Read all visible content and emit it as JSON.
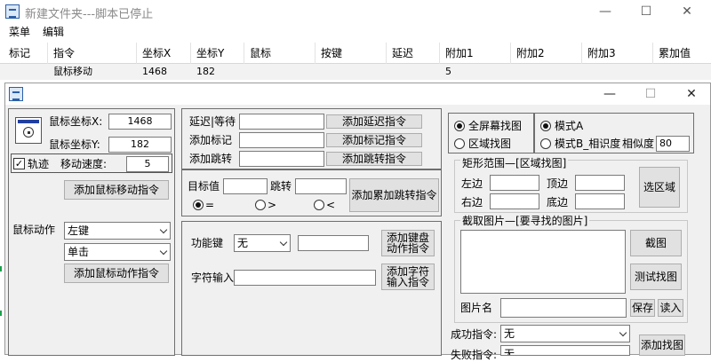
{
  "window": {
    "title": "新建文件夹---脚本已停止",
    "controls": {
      "minimize": "—",
      "maximize": "☐",
      "close": "✕"
    }
  },
  "menu": {
    "items": [
      "菜单",
      "编辑"
    ]
  },
  "grid": {
    "headers": [
      "标记",
      "指令",
      "坐标X",
      "坐标Y",
      "鼠标",
      "按键",
      "延迟",
      "附加1",
      "附加2",
      "附加3",
      "累加值"
    ],
    "rows": [
      {
        "mark": "",
        "cmd": "鼠标移动",
        "x": "1468",
        "y": "182",
        "mouse": "",
        "key": "",
        "delay": "",
        "add1": "5",
        "add2": "",
        "add3": "",
        "acc": ""
      }
    ]
  },
  "dialog": {
    "controls": {
      "minimize": "—",
      "maximize": "☐",
      "close": "✕"
    },
    "mouse": {
      "x_label": "鼠标坐标X:",
      "x_value": "1468",
      "y_label": "鼠标坐标Y:",
      "y_value": "182",
      "track_label": "轨迹",
      "track_checked": true,
      "speed_label": "移动速度:",
      "speed_value": "5",
      "add_move_btn": "添加鼠标移动指令",
      "action_label": "鼠标动作",
      "button_select": "左键",
      "click_select": "单击",
      "add_action_btn": "添加鼠标动作指令"
    },
    "delay": {
      "delay_label": "延迟|等待",
      "delay_value": "",
      "delay_btn": "添加延迟指令",
      "mark_label": "添加标记",
      "mark_value": "",
      "mark_btn": "添加标记指令",
      "jump_label": "添加跳转",
      "jump_value": "",
      "jump_btn": "添加跳转指令"
    },
    "target": {
      "target_label": "目标值",
      "target_value": "",
      "jump_label": "跳转",
      "jump_value": "",
      "btn": "添加累加跳转指令",
      "radios": [
        {
          "label": "=",
          "on": true
        },
        {
          "label": ">",
          "on": false
        },
        {
          "label": "<",
          "on": false
        }
      ]
    },
    "keyboard": {
      "func_label": "功能键",
      "func_select": "无",
      "key_value": "",
      "key_btn": "添加键盘动作指令",
      "text_label": "字符输入",
      "text_value": "",
      "text_btn": "添加字符输入指令"
    },
    "imagefind": {
      "scope_full": "全屏幕找图",
      "scope_area": "区域找图",
      "scope_selected": "full",
      "mode_a": "模式A",
      "mode_b": "模式B_相识度",
      "mode_selected": "A",
      "similarity_label": "相似度",
      "similarity_value": "80",
      "rect_title": "矩形范围—[区域找图]",
      "left_label": "左边",
      "top_label": "顶边",
      "right_label": "右边",
      "bottom_label": "底边",
      "left_value": "",
      "top_value": "",
      "right_value": "",
      "bottom_value": "",
      "select_area_btn": "选区域",
      "capture_title": "截取图片—[要寻找的图片]",
      "capture_btn": "截图",
      "test_btn": "测试找图",
      "name_label": "图片名",
      "name_value": "",
      "save_btn": "保存",
      "load_btn": "读入",
      "success_label": "成功指令:",
      "success_select": "无",
      "fail_label": "失败指令:",
      "fail_select": "无",
      "add_btn": "添加找图"
    }
  }
}
